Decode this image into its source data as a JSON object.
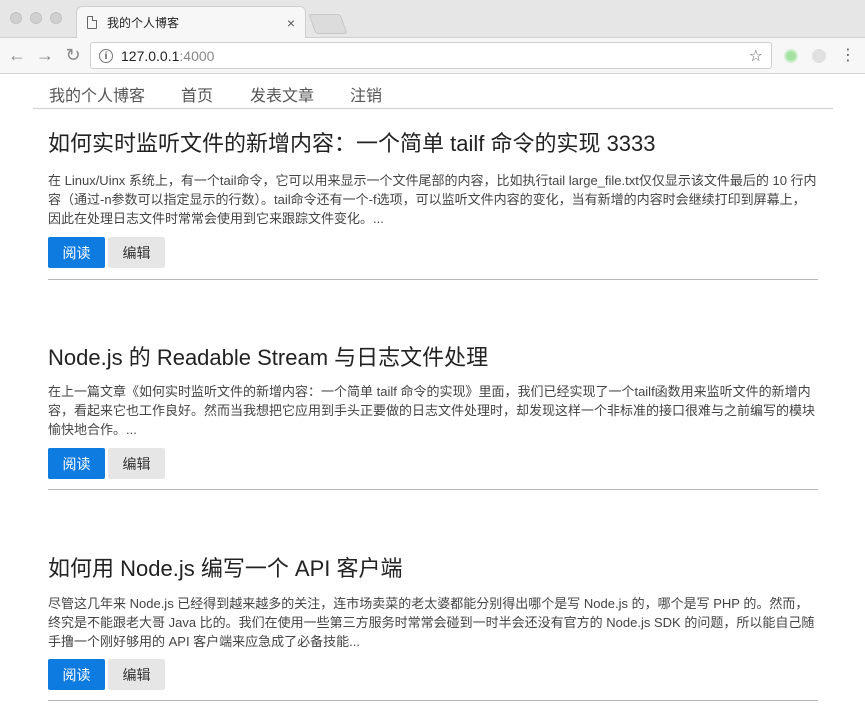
{
  "browser": {
    "tab_title": "我的个人博客",
    "tab_close": "×",
    "url_host": "127.0.0.1",
    "url_port": ":4000"
  },
  "nav": {
    "brand": "我的个人博客",
    "items": [
      {
        "label": "首页"
      },
      {
        "label": "发表文章"
      },
      {
        "label": "注销"
      }
    ]
  },
  "buttons": {
    "read": "阅读",
    "edit": "编辑"
  },
  "posts": [
    {
      "title": "如何实时监听文件的新增内容：一个简单 tailf 命令的实现 3333",
      "excerpt": "在 Linux/Uinx 系统上，有一个tail命令，它可以用来显示一个文件尾部的内容，比如执行tail large_file.txt仅仅显示该文件最后的 10 行内容（通过-n参数可以指定显示的行数）。tail命令还有一个-f选项，可以监听文件内容的变化，当有新增的内容时会继续打印到屏幕上，因此在处理日志文件时常常会使用到它来跟踪文件变化。..."
    },
    {
      "title": "Node.js 的 Readable Stream 与日志文件处理",
      "excerpt": "在上一篇文章《如何实时监听文件的新增内容：一个简单 tailf 命令的实现》里面，我们已经实现了一个tailf函数用来监听文件的新增内容，看起来它也工作良好。然而当我想把它应用到手头正要做的日志文件处理时，却发现这样一个非标准的接口很难与之前编写的模块愉快地合作。..."
    },
    {
      "title": "如何用 Node.js 编写一个 API 客户端",
      "excerpt": "尽管这几年来 Node.js 已经得到越来越多的关注，连市场卖菜的老太婆都能分别得出哪个是写 Node.js 的，哪个是写 PHP 的。然而，终究是不能跟老大哥 Java 比的。我们在使用一些第三方服务时常常会碰到一时半会还没有官方的 Node.js SDK 的问题，所以能自己随手撸一个刚好够用的 API 客户端来应急成了必备技能..."
    }
  ],
  "colors": {
    "primary": "#0e7be1",
    "secondary": "#e6e6e6"
  }
}
